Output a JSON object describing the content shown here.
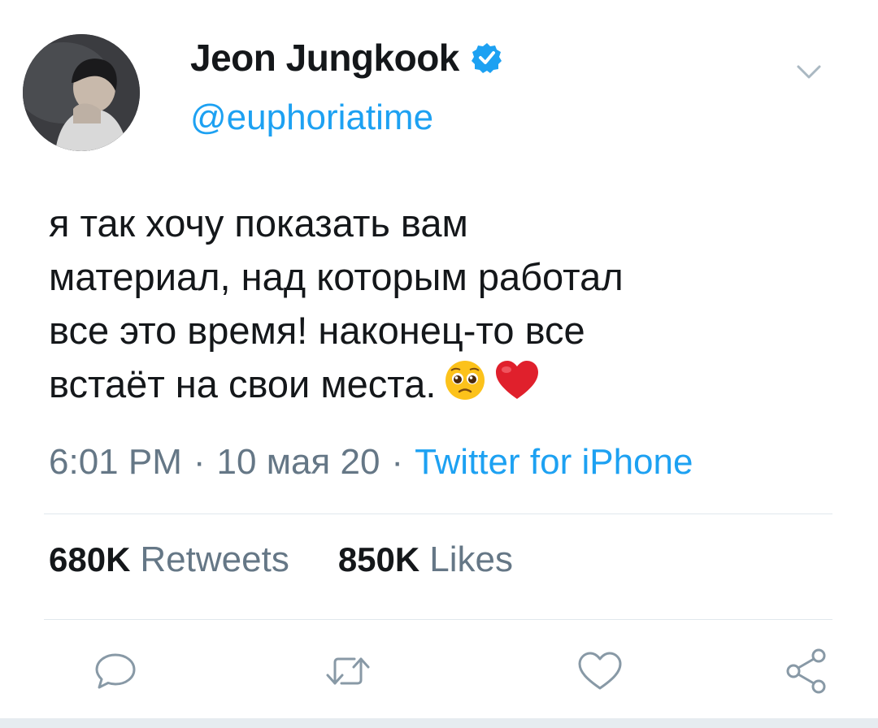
{
  "author": {
    "display_name": "Jeon Jungkook",
    "handle": "@euphoriatime",
    "verified": true,
    "avatar_icon": "profile-photo"
  },
  "tweet": {
    "text": "я так хочу показать вам\nматериал, над которым работал\nвсе это время! наконец-то все\nвстаёт на свои места.",
    "emojis": [
      "pleading-face-emoji",
      "red-heart-emoji"
    ]
  },
  "meta": {
    "time": "6:01 PM",
    "date": "10 мая 20",
    "separator": "·",
    "source": "Twitter for iPhone"
  },
  "stats": {
    "retweets_count": "680K",
    "retweets_label": "Retweets",
    "likes_count": "850K",
    "likes_label": "Likes"
  },
  "actions": [
    "reply-icon",
    "retweet-icon",
    "like-icon",
    "share-icon"
  ],
  "colors": {
    "accent": "#1da1f2",
    "text": "#14171a",
    "secondary": "#657786",
    "divider": "#e1e8ed",
    "icon": "#8899a6"
  }
}
